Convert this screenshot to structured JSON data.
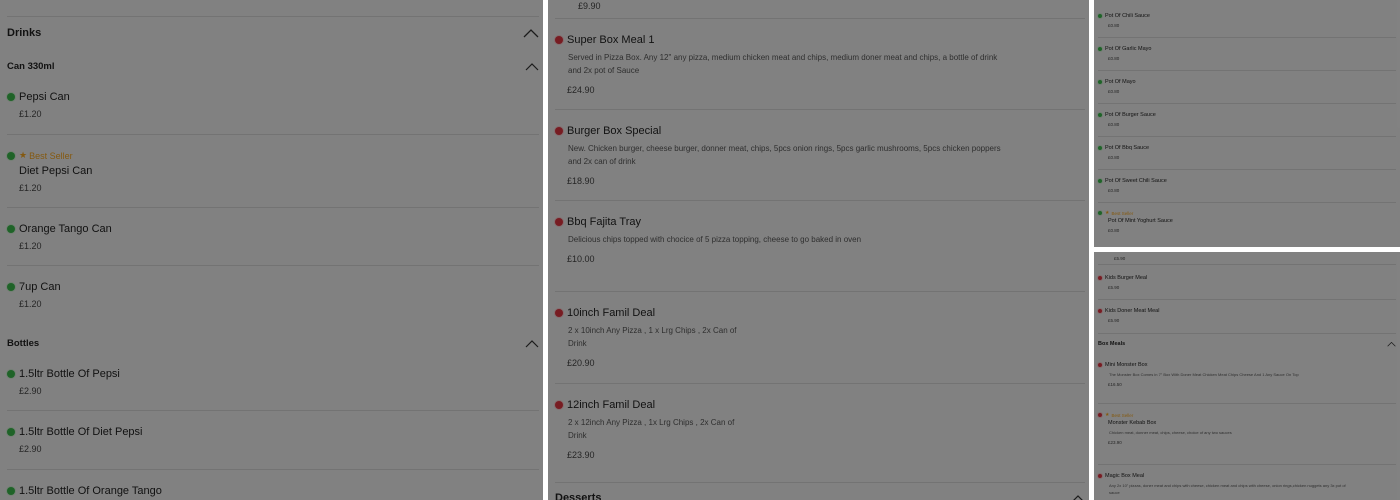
{
  "left_panel": {
    "drinks_header": "Drinks",
    "can_header": "Can 330ml",
    "cans": [
      {
        "name": "Pepsi Can",
        "price": "£1.20",
        "best": false
      },
      {
        "name": "Diet Pepsi Can",
        "price": "£1.20",
        "best": true
      },
      {
        "name": "Orange Tango Can",
        "price": "£1.20",
        "best": false
      },
      {
        "name": "7up Can",
        "price": "£1.20",
        "best": false
      }
    ],
    "bottles_header": "Bottles",
    "bottles": [
      {
        "name": "1.5ltr Bottle Of Pepsi",
        "price": "£2.90"
      },
      {
        "name": "1.5ltr Bottle Of Diet Pepsi",
        "price": "£2.90"
      },
      {
        "name": "1.5ltr Bottle Of Orange Tango",
        "price": ""
      }
    ],
    "best_seller_label": "Best Seller"
  },
  "middle_panel": {
    "top_price": "£9.90",
    "items": [
      {
        "name": "Super Box Meal 1",
        "desc": "Served in Pizza Box. Any 12\" any pizza, medium chicken meat and chips, medium doner meat and chips, a bottle of drink and 2x pot of Sauce",
        "price": "£24.90"
      },
      {
        "name": "Burger Box Special",
        "desc": "New. Chicken burger, cheese burger, donner meat, chips, 5pcs onion rings, 5pcs garlic mushrooms, 5pcs chicken poppers and 2x can of drink",
        "price": "£18.90"
      },
      {
        "name": "Bbq Fajita Tray",
        "desc": "Delicious chips topped with chocice of 5 pizza topping, cheese to go baked in oven",
        "price": "£10.00"
      },
      {
        "name": "10inch Famil Deal",
        "desc": "2 x 10inch Any Pizza , 1 x Lrg Chips , 2x Can of Drink",
        "price": "£20.90"
      },
      {
        "name": "12inch Famil Deal",
        "desc": "2 x 12inch Any Pizza , 1x Lrg Chips , 2x Can of Drink",
        "price": "£23.90"
      }
    ],
    "desserts_header": "Desserts"
  },
  "right_top": {
    "items": [
      {
        "name": "Pot Of Chili Sauce",
        "price": "£0.80"
      },
      {
        "name": "Pot Of Garlic Mayo",
        "price": "£0.80"
      },
      {
        "name": "Pot Of Mayo",
        "price": "£0.80"
      },
      {
        "name": "Pot Of Burger Sauce",
        "price": "£0.80"
      },
      {
        "name": "Pot Of Bbq Sauce",
        "price": "£0.80"
      },
      {
        "name": "Pot Of Sweet Chili Sauce",
        "price": "£0.80"
      },
      {
        "name": "Pot Of Mint Yoghurt Sauce",
        "price": "£0.80"
      }
    ],
    "best_seller_label": "Best Seller"
  },
  "right_bottom": {
    "top_price": "£5.90",
    "kids": [
      {
        "name": "Kids Burger Meal",
        "price": "£5.90"
      },
      {
        "name": "Kids Doner Meat Meal",
        "price": "£5.90"
      }
    ],
    "box_header": "Box Meals",
    "boxes": [
      {
        "name": "Mini Monster Box",
        "desc": "The Monster Box Comes in 7\" Box With Doner Meat Chicken Meat Chips Cheese And 1 Any Sauce On Top",
        "price": "£16.50",
        "best": false
      },
      {
        "name": "Monster Kebab Box",
        "desc": "Chicken meat, donner meat, chips, cheese, choice of any two sauces",
        "price": "£23.90",
        "best": true
      },
      {
        "name": "Magic Box Meal",
        "desc": "Any 2x 10\" pizzas, doner meat and chips with cheese, chicken meat and chips with cheese, onion rings,chicken nuggets any 3x pot of sauce",
        "price": "",
        "best": false
      }
    ],
    "best_seller_label": "Best Seller"
  },
  "colors": {
    "veg": "#39b54a",
    "nonveg": "#d9333f",
    "best": "#f0a31f"
  }
}
